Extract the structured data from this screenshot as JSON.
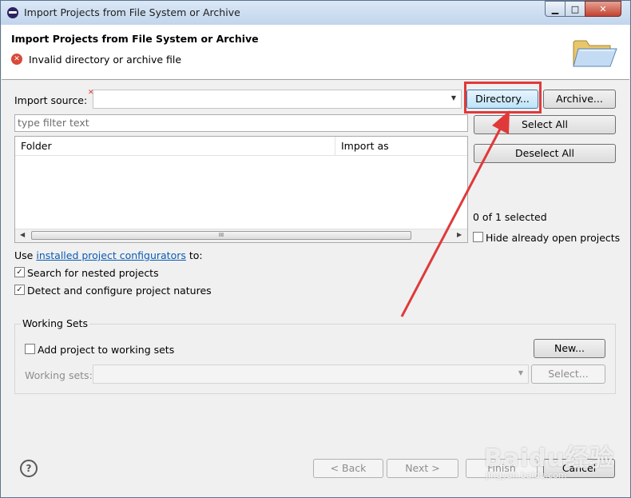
{
  "window": {
    "title": "Import Projects from File System or Archive",
    "controls": {
      "minimize": "▁",
      "maximize": "□",
      "close": "✕"
    }
  },
  "header": {
    "title": "Import Projects from File System or Archive",
    "message": "Invalid directory or archive file",
    "error_icon": "error-icon",
    "banner_icon": "open-folder-icon"
  },
  "source": {
    "label": "Import source:",
    "value": "",
    "directory_button": "Directory...",
    "archive_button": "Archive..."
  },
  "filter": {
    "placeholder": "type filter text"
  },
  "table": {
    "columns": [
      "Folder",
      "Import as"
    ],
    "rows": [],
    "scroll_thumb": "III"
  },
  "selection": {
    "select_all": "Select All",
    "deselect_all": "Deselect All",
    "count_text": "0 of 1 selected",
    "hide_open_label": "Hide already open projects",
    "hide_open_checked": false
  },
  "options": {
    "use_prefix": "Use",
    "configurators_link": "installed project configurators",
    "use_suffix": "to:",
    "nested_label": "Search for nested projects",
    "nested_checked": true,
    "natures_label": "Detect and configure project natures",
    "natures_checked": true
  },
  "working_sets": {
    "title": "Working Sets",
    "add_label": "Add project to working sets",
    "add_checked": false,
    "new_button": "New...",
    "sets_label": "Working sets:",
    "select_button": "Select..."
  },
  "footer": {
    "help": "?",
    "back": "< Back",
    "next": "Next >",
    "finish": "Finish",
    "cancel": "Cancel"
  },
  "annotation": {
    "highlight_color": "#e0393a"
  },
  "watermark": {
    "text": "Baidu经验",
    "sub": "jingyan.baidu.com"
  }
}
